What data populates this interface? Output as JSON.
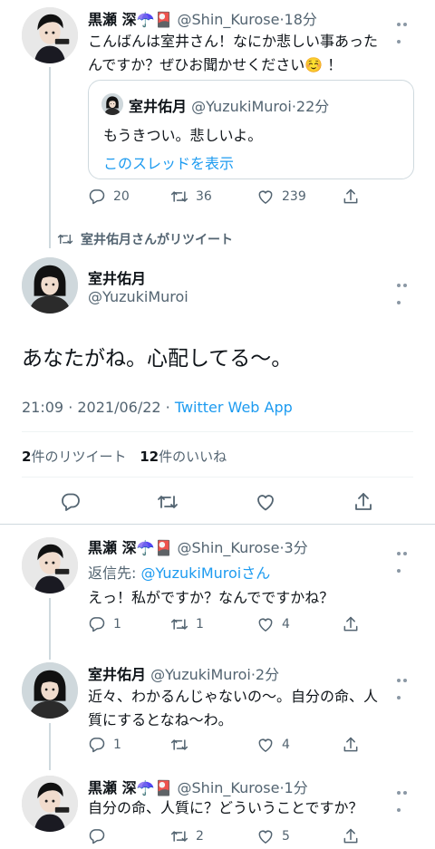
{
  "tweet1": {
    "name": "黒瀬 深☂️🎴",
    "handle": "@Shin_Kurose",
    "time": "·18分",
    "text_line1": "こんばんは室井さん！なにか悲しい事あった",
    "text_line2": "んですか？ぜひお聞かせください☺️ ！",
    "quote": {
      "name": "室井佑月",
      "handle": "@YuzukiMuroi",
      "time": "·22分",
      "text": "もうきつい。悲しいよ。",
      "link": "このスレッドを表示"
    },
    "replies": "20",
    "retweets": "36",
    "likes": "239"
  },
  "retweet_banner": "室井佑月さんがリツイート",
  "main_tweet": {
    "name": "室井佑月",
    "handle": "@YuzukiMuroi",
    "text": "あなたがね。心配してる〜。",
    "datetime": "21:09 · 2021/06/22 · ",
    "source": "Twitter Web App",
    "retweet_count": "2",
    "retweet_label": "件のリツイート",
    "like_count": "12",
    "like_label": "件のいいね"
  },
  "reply1": {
    "name": "黒瀬 深☂️🎴",
    "handle": "@Shin_Kurose",
    "time": "·3分",
    "reply_to_prefix": "返信先: ",
    "reply_to_handle": "@YuzukiMuroi",
    "reply_to_suffix": "さん",
    "text": "えっ！私がですか？なんでですかね？",
    "replies": "1",
    "retweets": "1",
    "likes": "4"
  },
  "reply2": {
    "name": "室井佑月",
    "handle": "@YuzukiMuroi",
    "time": "·2分",
    "text_line1": "近々、わかるんじゃないの〜。自分の命、人",
    "text_line2": "質にするとなね〜わ。",
    "replies": "1",
    "likes": "4"
  },
  "reply3": {
    "name": "黒瀬 深☂️🎴",
    "handle": "@Shin_Kurose",
    "time": "·1分",
    "text": "自分の命、人質に？どういうことですか？",
    "retweets": "2",
    "likes": "5"
  },
  "colors": {
    "accent": "#1d9bf0",
    "secondary": "#536471",
    "line": "#cfd9de"
  },
  "icons": [
    "reply-icon",
    "retweet-icon",
    "like-icon",
    "share-icon",
    "more-icon"
  ]
}
